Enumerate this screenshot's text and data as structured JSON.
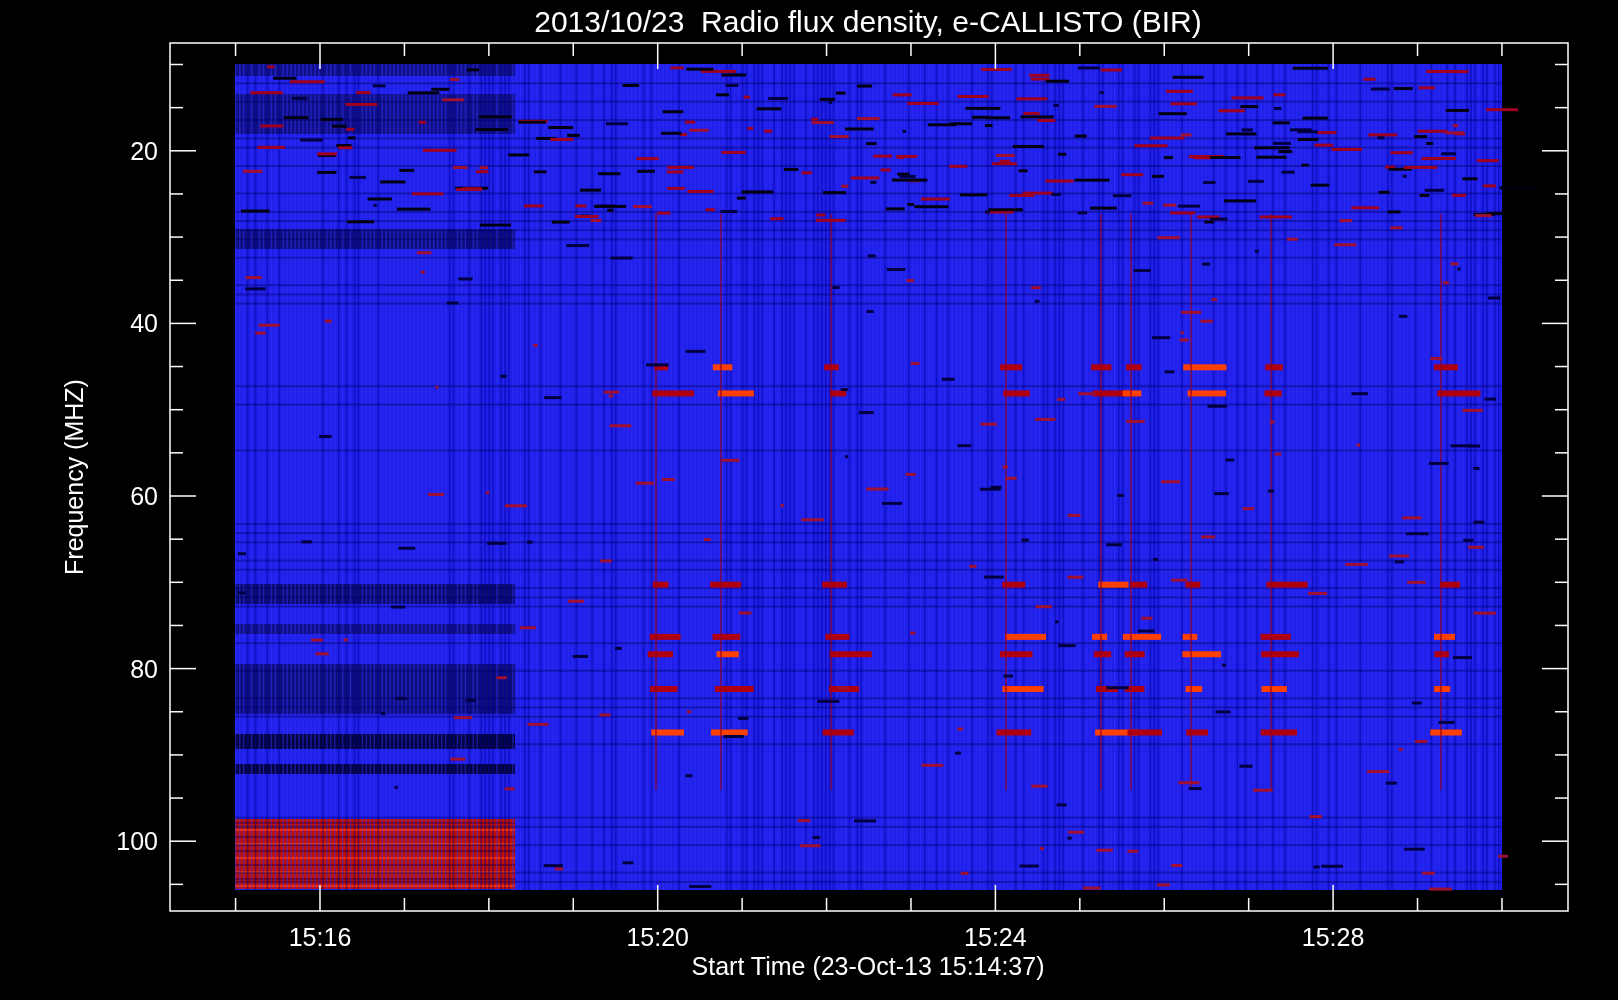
{
  "title": "2013/10/23  Radio flux density, e-CALLISTO (BIR)",
  "plot": {
    "ylabel": "Frequency (MHZ)",
    "xlabel": "Start Time (23-Oct-13 15:14:37)",
    "yticks": [
      "20",
      "40",
      "60",
      "80",
      "100"
    ],
    "xticks": [
      "15:16",
      "15:20",
      "15:24",
      "15:28"
    ]
  }
}
